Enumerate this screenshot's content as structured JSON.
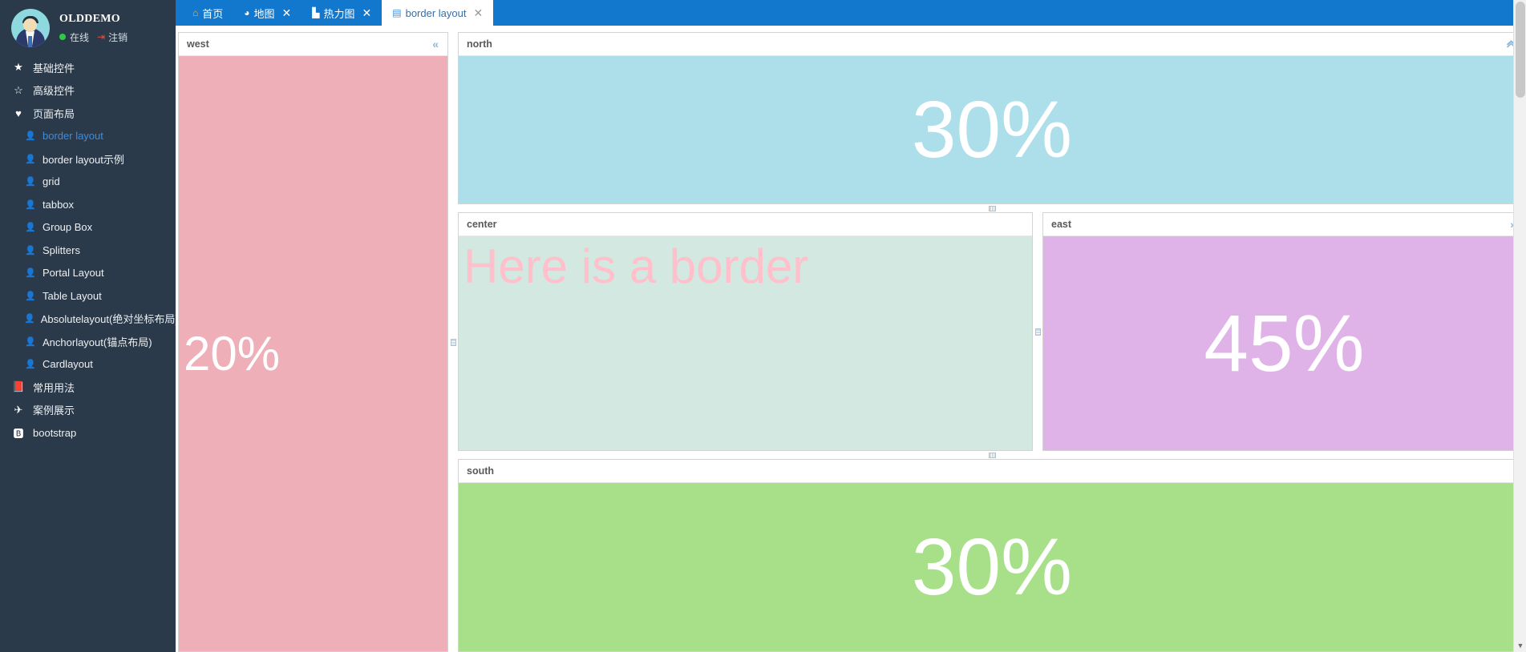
{
  "sidebar": {
    "user": {
      "name": "OLDDEMO",
      "status_text": "在线",
      "logout_text": "注销",
      "status_color": "#2ecc40",
      "logout_color": "#e74c3c"
    },
    "items": [
      {
        "label": "基础控件",
        "icon": "star-filled-icon",
        "glyph": "★",
        "level": 0,
        "active": false
      },
      {
        "label": "高级控件",
        "icon": "star-outline-icon",
        "glyph": "☆",
        "level": 0,
        "active": false
      },
      {
        "label": "页面布局",
        "icon": "heart-icon",
        "glyph": "♥",
        "level": 0,
        "active": false
      },
      {
        "label": "border layout",
        "icon": "user-icon",
        "glyph": "👤",
        "level": 1,
        "active": true
      },
      {
        "label": "border layout示例",
        "icon": "user-icon",
        "glyph": "👤",
        "level": 1,
        "active": false
      },
      {
        "label": "grid",
        "icon": "user-icon",
        "glyph": "👤",
        "level": 1,
        "active": false
      },
      {
        "label": "tabbox",
        "icon": "user-icon",
        "glyph": "👤",
        "level": 1,
        "active": false
      },
      {
        "label": "Group Box",
        "icon": "user-icon",
        "glyph": "👤",
        "level": 1,
        "active": false
      },
      {
        "label": "Splitters",
        "icon": "user-icon",
        "glyph": "👤",
        "level": 1,
        "active": false
      },
      {
        "label": "Portal Layout",
        "icon": "user-icon",
        "glyph": "👤",
        "level": 1,
        "active": false
      },
      {
        "label": "Table Layout",
        "icon": "user-icon",
        "glyph": "👤",
        "level": 1,
        "active": false
      },
      {
        "label": "Absolutelayout(绝对坐标布局)",
        "icon": "user-icon",
        "glyph": "👤",
        "level": 1,
        "active": false
      },
      {
        "label": "Anchorlayout(锚点布局)",
        "icon": "user-icon",
        "glyph": "👤",
        "level": 1,
        "active": false
      },
      {
        "label": "Cardlayout",
        "icon": "user-icon",
        "glyph": "👤",
        "level": 1,
        "active": false
      },
      {
        "label": "常用用法",
        "icon": "book-icon",
        "glyph": "📕",
        "level": 0,
        "active": false
      },
      {
        "label": "案例展示",
        "icon": "plane-icon",
        "glyph": "✈",
        "level": 0,
        "active": false
      },
      {
        "label": "bootstrap",
        "icon": "bootstrap-icon",
        "glyph": "🅱",
        "level": 0,
        "active": false
      }
    ]
  },
  "tabs": [
    {
      "label": "首页",
      "icon": "home-icon",
      "glyph": "⌂",
      "icon_color": "#ffb347",
      "closable": false,
      "active": false
    },
    {
      "label": "地图",
      "icon": "globe-icon",
      "glyph": "◕",
      "icon_color": "#ffffff",
      "closable": true,
      "active": false
    },
    {
      "label": "热力图",
      "icon": "chart-icon",
      "glyph": "▙",
      "icon_color": "#ffffff",
      "closable": true,
      "active": false
    },
    {
      "label": "border layout",
      "icon": "layout-icon",
      "glyph": "▤",
      "icon_color": "#3c8dde",
      "closable": true,
      "active": true
    }
  ],
  "panels": {
    "west": {
      "title": "west",
      "value": "20%",
      "bg": "#eeafb8",
      "tool_icon": "collapse-left-icon",
      "tool_glyph": "«"
    },
    "north": {
      "title": "north",
      "value": "30%",
      "bg": "#addfeb",
      "tool_icon": "collapse-up-icon",
      "tool_glyph": "⌃"
    },
    "center": {
      "title": "center",
      "value": "Here is a border",
      "bg": "#d2e8e0",
      "text_color": "#ffc0cb",
      "tool_icon": "",
      "tool_glyph": ""
    },
    "east": {
      "title": "east",
      "value": "45%",
      "bg": "#e0b3e8",
      "tool_icon": "collapse-right-icon",
      "tool_glyph": "»"
    },
    "south": {
      "title": "south",
      "value": "30%",
      "bg": "#a8e08a",
      "tool_icon": "",
      "tool_glyph": ""
    }
  },
  "colors": {
    "tabbar_blue": "#1278cd",
    "sidebar_dark": "#2b3a4a",
    "active_link": "#3c8dde"
  }
}
